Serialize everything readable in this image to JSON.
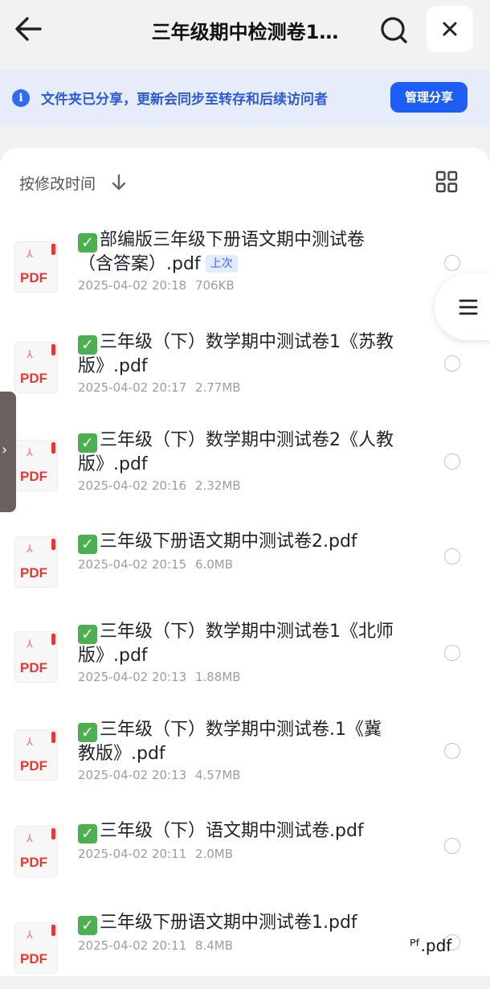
{
  "header": {
    "title": "三年级期中检测卷1…",
    "back_icon": "back-arrow-icon",
    "search_icon": "search-icon",
    "close_icon": "close-icon"
  },
  "notice": {
    "info_icon": "i",
    "text": "文件夹已分享，更新会同步至转存和后续访问者",
    "button_label": "管理分享"
  },
  "toolbar": {
    "sort_label": "按修改时间",
    "sort_icon": "arrow-down-icon",
    "view_icon": "grid-view-icon"
  },
  "files": [
    {
      "check": "✓",
      "name": "部编版三年级下册语文期中测试卷（含答案）.pdf",
      "badge": "上次",
      "date": "2025-04-02 20:18",
      "size": "706KB",
      "type": "PDF"
    },
    {
      "check": "✓",
      "name": "三年级（下）数学期中测试卷1《苏教版》.pdf",
      "badge": "",
      "date": "2025-04-02 20:17",
      "size": "2.77MB",
      "type": "PDF"
    },
    {
      "check": "✓",
      "name": "三年级（下）数学期中测试卷2《人教版》.pdf",
      "badge": "",
      "date": "2025-04-02 20:16",
      "size": "2.32MB",
      "type": "PDF"
    },
    {
      "check": "✓",
      "name": "三年级下册语文期中测试卷2.pdf",
      "badge": "",
      "date": "2025-04-02 20:15",
      "size": "6.0MB",
      "type": "PDF"
    },
    {
      "check": "✓",
      "name": "三年级（下）数学期中测试卷1《北师版》.pdf",
      "badge": "",
      "date": "2025-04-02 20:13",
      "size": "1.88MB",
      "type": "PDF"
    },
    {
      "check": "✓",
      "name": "三年级（下）数学期中测试卷.1《冀教版》.pdf",
      "badge": "",
      "date": "2025-04-02 20:13",
      "size": "4.57MB",
      "type": "PDF"
    },
    {
      "check": "✓",
      "name": "三年级（下）语文期中测试卷.pdf",
      "badge": "",
      "date": "2025-04-02 20:11",
      "size": "2.0MB",
      "type": "PDF"
    },
    {
      "check": "✓",
      "name": "三年级下册语文期中测试卷1.pdf",
      "badge": "",
      "date": "2025-04-02 20:11",
      "size": "8.4MB",
      "type": "PDF"
    }
  ],
  "side_tab": {
    "glyph": "›"
  },
  "floating_menu": {
    "icon": "menu-icon"
  },
  "watermark": "ᴾᶠ.pdf",
  "colors": {
    "accent": "#1e5ef5",
    "notice_bg": "#e6ecfa",
    "pdf_red": "#e53935",
    "check_green": "#4caf50"
  }
}
